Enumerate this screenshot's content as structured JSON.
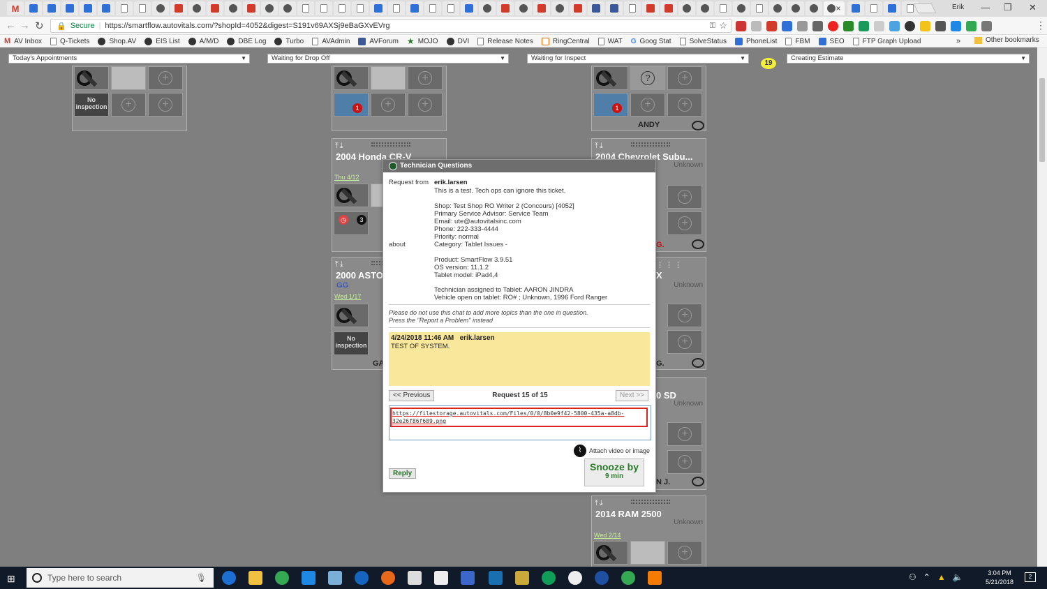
{
  "browser": {
    "address": {
      "secure_label": "Secure",
      "url": "https://smartflow.autovitals.com/?shopId=4052&digest=S191v69AXSj9eBaGXvEVrg"
    },
    "user_label": "Erik",
    "bookmarks": [
      {
        "label": "AV Inbox",
        "icon": "gmail-icon"
      },
      {
        "label": "Q-Tickets",
        "icon": "doc-icon"
      },
      {
        "label": "Shop.AV",
        "icon": "autovitals-icon"
      },
      {
        "label": "EIS List",
        "icon": "autovitals-icon"
      },
      {
        "label": "A/M/D",
        "icon": "autovitals-icon"
      },
      {
        "label": "DBE Log",
        "icon": "autovitals-icon"
      },
      {
        "label": "Turbo",
        "icon": "autovitals-icon"
      },
      {
        "label": "AVAdmin",
        "icon": "doc-icon"
      },
      {
        "label": "AVForum",
        "icon": "facebook-icon"
      },
      {
        "label": "MOJO",
        "icon": "star-icon"
      },
      {
        "label": "DVI",
        "icon": "autovitals-icon"
      },
      {
        "label": "Release Notes",
        "icon": "doc-icon"
      },
      {
        "label": "RingCentral",
        "icon": "ringcentral-icon"
      },
      {
        "label": "WAT",
        "icon": "doc-icon"
      },
      {
        "label": "Goog Stat",
        "icon": "google-icon"
      },
      {
        "label": "SolveStatus",
        "icon": "doc-icon"
      },
      {
        "label": "PhoneList",
        "icon": "blue-icon"
      },
      {
        "label": "FBM",
        "icon": "doc-icon"
      },
      {
        "label": "SEO",
        "icon": "blue-icon"
      },
      {
        "label": "FTP Graph Upload",
        "icon": "doc-icon"
      }
    ],
    "bookmarks_more": "»",
    "other_bookmarks": "Other bookmarks"
  },
  "filters": {
    "col1": "Today's Appointments",
    "col2": "Waiting for Drop Off",
    "col3": "Waiting for Inspect",
    "count_badge": "19",
    "col4": "Creating Estimate"
  },
  "board": {
    "no_inspection": "No inspection",
    "cards": {
      "c2_title": "2004 Honda CR-V",
      "c2_date": "Thu 4/12",
      "c2_badge": "3",
      "c3_title": "2000 ASTO",
      "c3_tag": "GG",
      "c3_date": "Wed 1/17",
      "c3_tail": "GA",
      "col3_top_name": "ANDY",
      "c4_title": "2004 Chevrolet Subu...",
      "c4_unknown": "Unknown",
      "c4_tail": "G.",
      "c5_title": "X",
      "c5_unknown": "Unknown",
      "c5_tail": "G.",
      "c6_title": "0 SD",
      "c6_unknown": "Unknown",
      "c6_tail": "N J.",
      "c7_title": "2014 RAM 2500",
      "c7_unknown": "Unknown",
      "c7_date": "Wed 2/14",
      "badge_one": "1"
    }
  },
  "modal": {
    "title": "Technician Questions",
    "request_from_label": "Request from",
    "about_label": "about",
    "user": "erik.larsen",
    "summary": "This is a test. Tech ops can ignore this ticket.",
    "details": [
      "Shop: Test Shop RO Writer 2 (Concours) [4052]",
      "Primary Service Advisor: Service Team",
      "Email: ute@autovitalsinc.com",
      "Phone: 222-333-4444",
      "Priority: normal",
      "Category: Tablet Issues -"
    ],
    "product": [
      "Product: SmartFlow 3.9.51",
      "OS version: 11.1.2",
      "Tablet model: iPad4,4"
    ],
    "tablet": [
      "Technician assigned to Tablet: AARON JINDRA",
      "Vehicle open on tablet: RO# ; Unknown, 1996 Ford Ranger"
    ],
    "notice": [
      "Please do not use this chat to add more topics than the one in question.",
      "Press the \"Report a Problem\" instead"
    ],
    "message": {
      "timestamp": "4/24/2018 11:46 AM",
      "author": "erik.larsen",
      "text": "TEST OF SYSTEM."
    },
    "prev_label": "<< Previous",
    "request_count": "Request 15 of 15",
    "next_label": "Next >>",
    "reply_value_line1": "https://filestorage.autovitals.com/Files/0/0/8b0e9f42-5800-435a-a8db-",
    "reply_value_line2": "32e26f86f689.png",
    "attach_label": "Attach video or image",
    "reply_label": "Reply",
    "snooze_label": "Snooze by",
    "snooze_value": "9 min"
  },
  "taskbar": {
    "search_placeholder": "Type here to search",
    "time": "3:04 PM",
    "date": "5/21/2018"
  },
  "colors": {
    "board_bg": "#7f7f7f",
    "message_bg": "#f9e79b",
    "accent_green": "#2a7a2a",
    "highlight_red": "#dd2222",
    "badge_yellow": "#f2ef3a"
  }
}
